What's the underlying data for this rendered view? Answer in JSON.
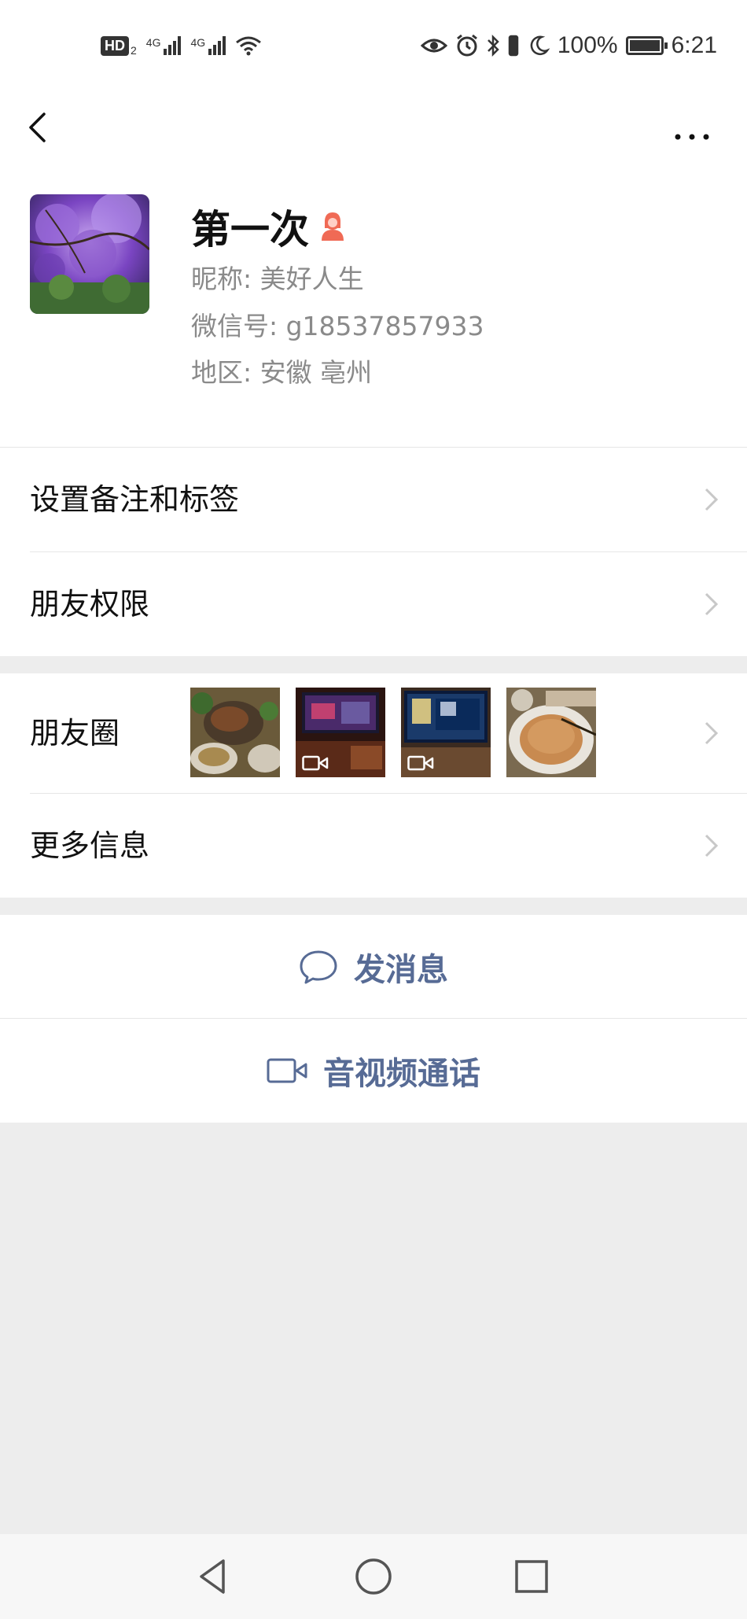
{
  "status_bar": {
    "hd_label": "HD",
    "hd_sub": "2",
    "sim1_label": "4G",
    "sim2_label": "4G",
    "battery_percent": "100%",
    "time": "6:21",
    "icons": [
      "eye-icon",
      "alarm-icon",
      "bluetooth-icon",
      "vibrate-icon",
      "moon-icon",
      "battery-icon"
    ]
  },
  "navbar": {
    "back_icon": "chevron-left-icon",
    "more_icon": "more-dots-icon"
  },
  "profile": {
    "name": "第一次",
    "gender_icon": "female-icon",
    "nickname": "昵称:  美好人生",
    "wechat_id": "微信号:  g18537857933",
    "region": "地区:  安徽  亳州"
  },
  "menu": {
    "remark_tags": "设置备注和标签",
    "friend_permissions": "朋友权限",
    "moments": "朋友圈",
    "more_info": "更多信息"
  },
  "moments_thumbs": [
    {
      "kind": "photo",
      "video": false
    },
    {
      "kind": "video",
      "video": true
    },
    {
      "kind": "video",
      "video": true
    },
    {
      "kind": "photo",
      "video": false
    }
  ],
  "actions": {
    "send_message": "发消息",
    "av_call": "音视频通话"
  },
  "colors": {
    "accent": "#576b95",
    "female_icon": "#f06a55",
    "background": "#ededed"
  }
}
